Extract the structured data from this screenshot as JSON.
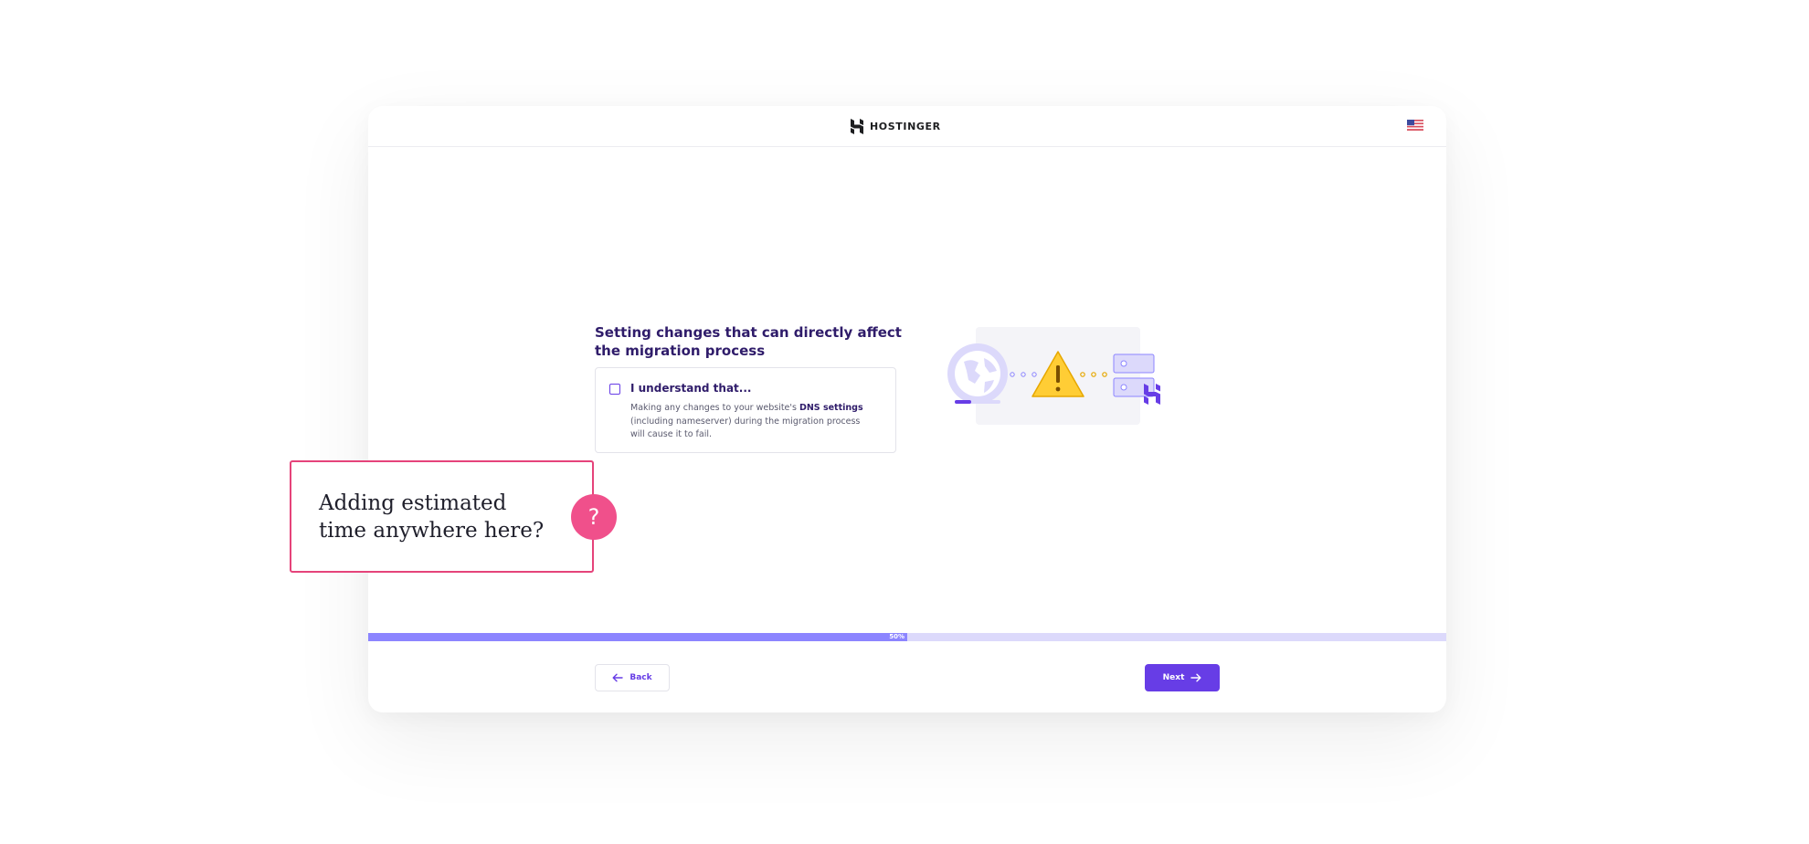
{
  "brand": {
    "name": "HOSTINGER"
  },
  "language": {
    "flag": "us-flag-icon"
  },
  "step": {
    "heading": "Setting changes that can directly affect the migration process",
    "consent": {
      "title": "I understand that...",
      "text_before": "Making any changes to your website's ",
      "text_bold": "DNS settings",
      "text_after": " (including nameserver) during the migration process will cause it to fail.",
      "checked": false
    }
  },
  "progress": {
    "label": "50%",
    "fraction": 0.5
  },
  "nav": {
    "back_label": "Back",
    "next_label": "Next"
  },
  "annotation": {
    "text": "Adding estimated time anywhere here?",
    "badge": "?"
  },
  "colors": {
    "accent": "#673de6",
    "progress_fill": "#8c85ff",
    "progress_track": "#dcd9fb",
    "annotation": "#e5437a",
    "badge": "#f0508b",
    "warning": "#ffcd35"
  }
}
